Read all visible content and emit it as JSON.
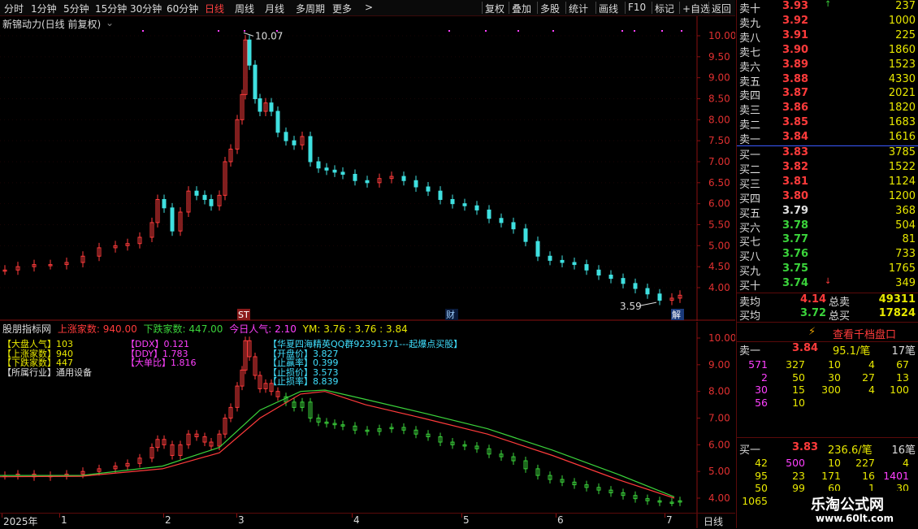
{
  "toolbar": {
    "periods": [
      "分时",
      "1分钟",
      "5分钟",
      "15分钟",
      "30分钟",
      "60分钟",
      "日线",
      "周线",
      "月线",
      "多周期",
      "更多"
    ],
    "active_period": "日线",
    "more_arrow": ">",
    "actions": [
      "复权",
      "叠加",
      "多股",
      "统计",
      "画线",
      "F10",
      "标记",
      "+自选",
      "返回"
    ]
  },
  "main_chart": {
    "title": "新锦动力(日线 前复权)",
    "title_arrow": "⌄",
    "y_ticks": [
      "10.00",
      "9.50",
      "9.00",
      "8.50",
      "8.00",
      "7.50",
      "7.00",
      "6.50",
      "6.00",
      "5.50",
      "5.00",
      "4.50",
      "4.00"
    ],
    "high_label": "10.07",
    "low_label": "3.59",
    "markers": {
      "st": "ST",
      "cai": "财",
      "jie": "解"
    }
  },
  "indicator": {
    "name": "股朋指标网",
    "up_label": "上涨家数:",
    "up_value": "940.00",
    "down_label": "下跌家数:",
    "down_value": "447.00",
    "pop_label": "今日人气:",
    "pop_value": "2.10",
    "ym_label": "YM:",
    "ym_values": "3.76 : 3.76 : 3.84",
    "y_ticks": [
      "10.00",
      "9.00",
      "8.00",
      "7.00",
      "6.00",
      "5.00",
      "4.00"
    ],
    "left_labels": [
      {
        "text": "【大盘人气】103",
        "color": "#e8e800"
      },
      {
        "text": "【上涨家数】940",
        "color": "#e8e800"
      },
      {
        "text": "【下跌家数】447",
        "color": "#e8e800"
      },
      {
        "text": "【所属行业】通用设备",
        "color": "#e0e0e0"
      }
    ],
    "mid_labels": [
      {
        "text": "【DDX】0.121",
        "color": "#ff40ff"
      },
      {
        "text": "【DDY】1.783",
        "color": "#ff40ff"
      },
      {
        "text": "【大单比】1.816",
        "color": "#ff40ff"
      }
    ],
    "right_labels": [
      "【华夏四海精英QQ群92391371---起爆点买股】",
      "【开盘价】3.827",
      "【止赢率】0.399",
      "【止损价】3.573",
      "【止损率】8.839"
    ]
  },
  "x_axis": {
    "labels": [
      "2025年",
      "1",
      "2",
      "3",
      "4",
      "5",
      "6",
      "7"
    ],
    "period_label": "日线"
  },
  "quotes": {
    "sell": [
      {
        "label": "卖十",
        "price": "3.93",
        "vol": "237",
        "mark": "↑"
      },
      {
        "label": "卖九",
        "price": "3.92",
        "vol": "1000"
      },
      {
        "label": "卖八",
        "price": "3.91",
        "vol": "225"
      },
      {
        "label": "卖七",
        "price": "3.90",
        "vol": "1860"
      },
      {
        "label": "卖六",
        "price": "3.89",
        "vol": "1523"
      },
      {
        "label": "卖五",
        "price": "3.88",
        "vol": "4330"
      },
      {
        "label": "卖四",
        "price": "3.87",
        "vol": "2021"
      },
      {
        "label": "卖三",
        "price": "3.86",
        "vol": "1820"
      },
      {
        "label": "卖二",
        "price": "3.85",
        "vol": "1683"
      },
      {
        "label": "卖一",
        "price": "3.84",
        "vol": "1616"
      }
    ],
    "buy": [
      {
        "label": "买一",
        "price": "3.83",
        "vol": "3785",
        "color": "red"
      },
      {
        "label": "买二",
        "price": "3.82",
        "vol": "1522",
        "color": "red"
      },
      {
        "label": "买三",
        "price": "3.81",
        "vol": "1124",
        "color": "red"
      },
      {
        "label": "买四",
        "price": "3.80",
        "vol": "1200",
        "color": "red"
      },
      {
        "label": "买五",
        "price": "3.79",
        "vol": "368",
        "color": "wht"
      },
      {
        "label": "买六",
        "price": "3.78",
        "vol": "504",
        "color": "grn"
      },
      {
        "label": "买七",
        "price": "3.77",
        "vol": "81",
        "color": "grn"
      },
      {
        "label": "买八",
        "price": "3.76",
        "vol": "733",
        "color": "grn"
      },
      {
        "label": "买九",
        "price": "3.75",
        "vol": "1765",
        "color": "grn"
      },
      {
        "label": "买十",
        "price": "3.74",
        "vol": "349",
        "color": "grn",
        "mark": "↓"
      }
    ],
    "avg_sell_label": "卖均",
    "avg_sell": "4.14",
    "total_sell_label": "总卖",
    "total_sell": "49311",
    "avg_buy_label": "买均",
    "avg_buy": "3.72",
    "total_buy_label": "总买",
    "total_buy": "17824"
  },
  "depth": {
    "button": "查看千档盘口",
    "sell1_label": "卖一",
    "sell1_price": "3.84",
    "sell1_avg": "95.1/笔",
    "sell1_count": "17笔",
    "sell_rows": [
      [
        "571",
        "327",
        "10",
        "4",
        "67"
      ],
      [
        "2",
        "50",
        "30",
        "27",
        "13"
      ],
      [
        "30",
        "15",
        "300",
        "4",
        "100"
      ],
      [
        "56",
        "10",
        "",
        "",
        ""
      ]
    ],
    "buy1_label": "买一",
    "buy1_price": "3.83",
    "buy1_avg": "236.6/笔",
    "buy1_count": "16笔",
    "buy_rows": [
      [
        "42",
        "500",
        "10",
        "227",
        "4"
      ],
      [
        "95",
        "23",
        "171",
        "16",
        "1401"
      ],
      [
        "50",
        "99",
        "60",
        "1",
        "30"
      ],
      [
        "1065",
        "",
        "",
        "",
        ""
      ]
    ]
  },
  "watermark": {
    "line1": "乐淘公式网",
    "line2": "www.60lt.com"
  }
}
